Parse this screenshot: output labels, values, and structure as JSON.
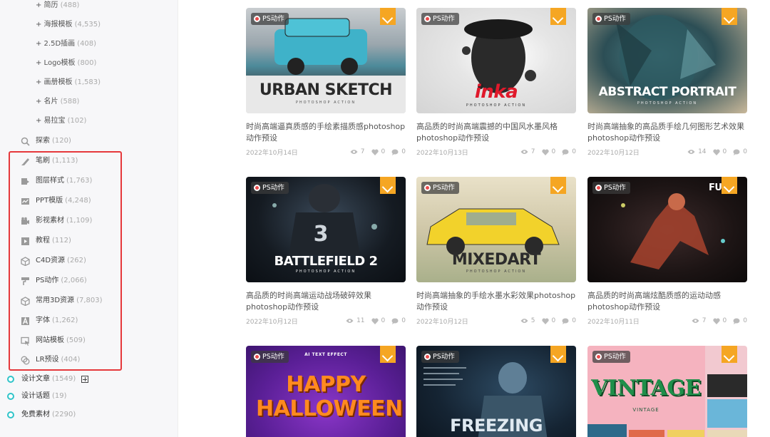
{
  "sidebar": {
    "sub_items": [
      {
        "label": "+ 简历",
        "count": "(488)"
      },
      {
        "label": "+ 海报模板",
        "count": "(4,535)"
      },
      {
        "label": "+ 2.5D插画",
        "count": "(408)"
      },
      {
        "label": "+ Logo模板",
        "count": "(800)"
      },
      {
        "label": "+ 画册模板",
        "count": "(1,583)"
      },
      {
        "label": "+ 名片",
        "count": "(588)"
      },
      {
        "label": "+ 易拉宝",
        "count": "(102)"
      }
    ],
    "explore": {
      "label": "探索",
      "count": "(120)",
      "icon": "search-icon"
    },
    "categories": [
      {
        "label": "笔刷",
        "count": "(1,113)",
        "icon": "brush-icon"
      },
      {
        "label": "图层样式",
        "count": "(1,763)",
        "icon": "layer-style-icon"
      },
      {
        "label": "PPT模版",
        "count": "(4,248)",
        "icon": "ppt-icon"
      },
      {
        "label": "影视素材",
        "count": "(1,109)",
        "icon": "video-camera-icon"
      },
      {
        "label": "教程",
        "count": "(112)",
        "icon": "play-icon"
      },
      {
        "label": "C4D资源",
        "count": "(262)",
        "icon": "cube-icon"
      },
      {
        "label": "PS动作",
        "count": "(2,066)",
        "icon": "paint-roller-icon"
      },
      {
        "label": "常用3D资源",
        "count": "(7,803)",
        "icon": "box-3d-icon"
      },
      {
        "label": "字体",
        "count": "(1,262)",
        "icon": "font-icon"
      },
      {
        "label": "网站模板",
        "count": "(509)",
        "icon": "website-cursor-icon"
      },
      {
        "label": "LR预设",
        "count": "(404)",
        "icon": "lr-preset-icon"
      }
    ],
    "top_items": [
      {
        "label": "设计文章",
        "count": "(1549)",
        "expandable": true
      },
      {
        "label": "设计话题",
        "count": "(19)",
        "expandable": false
      },
      {
        "label": "免费素材",
        "count": "(2290)",
        "expandable": false
      }
    ],
    "dot_color": "#2fc4c9",
    "highlight_color": "#e5383b"
  },
  "tag_label": "PS动作",
  "bookmark_color": "#f5a623",
  "cards": [
    {
      "thumb_title": "URBAN SKETCH",
      "thumb_sub": "PHOTOSHOP ACTION",
      "title": "时尚高端逼真质感的手绘素描质感photoshop动作预设",
      "date": "2022年10月14日",
      "views": "7",
      "likes": "0",
      "comments": "0"
    },
    {
      "thumb_title": "inka",
      "thumb_sub": "PHOTOSHOP ACTION",
      "title": "高品质的时尚高端震撼的中国风水墨风格photoshop动作预设",
      "date": "2022年10月13日",
      "views": "7",
      "likes": "0",
      "comments": "0"
    },
    {
      "thumb_title": "ABSTRACT PORTRAIT",
      "thumb_sub": "PHOTOSHOP ACTION",
      "title": "时尚高端抽象的高品质手绘几何图形艺术效果photoshop动作预设",
      "date": "2022年10月12日",
      "views": "14",
      "likes": "0",
      "comments": "0"
    },
    {
      "thumb_title": "BATTLEFIELD 2",
      "thumb_sub": "PHOTOSHOP ACTION",
      "title": "高品质的时尚高端运动战场破碎效果photoshop动作预设",
      "date": "2022年10月12日",
      "views": "11",
      "likes": "0",
      "comments": "0"
    },
    {
      "thumb_title": "MIXEDART",
      "thumb_sub": "PHOTOSHOP ACTION",
      "title": "时尚高端抽象的手绘水墨水彩效果photoshop动作预设",
      "date": "2022年10月12日",
      "views": "5",
      "likes": "0",
      "comments": "0"
    },
    {
      "thumb_title": "FU",
      "thumb_sub": "",
      "title": "高品质的时尚高端炫酷质感的运动动感photoshop动作预设",
      "date": "2022年10月11日",
      "views": "7",
      "likes": "0",
      "comments": "0"
    },
    {
      "thumb_title": "HAPPY HALLOWEEN",
      "thumb_sub": "AI TEXT EFFECT",
      "title": "",
      "date": "",
      "views": "",
      "likes": "",
      "comments": ""
    },
    {
      "thumb_title": "FREEZING",
      "thumb_sub": "",
      "title": "",
      "date": "",
      "views": "",
      "likes": "",
      "comments": ""
    },
    {
      "thumb_title": "VINTAGE",
      "thumb_sub": "VINTAGE",
      "title": "",
      "date": "",
      "views": "",
      "likes": "",
      "comments": ""
    }
  ]
}
